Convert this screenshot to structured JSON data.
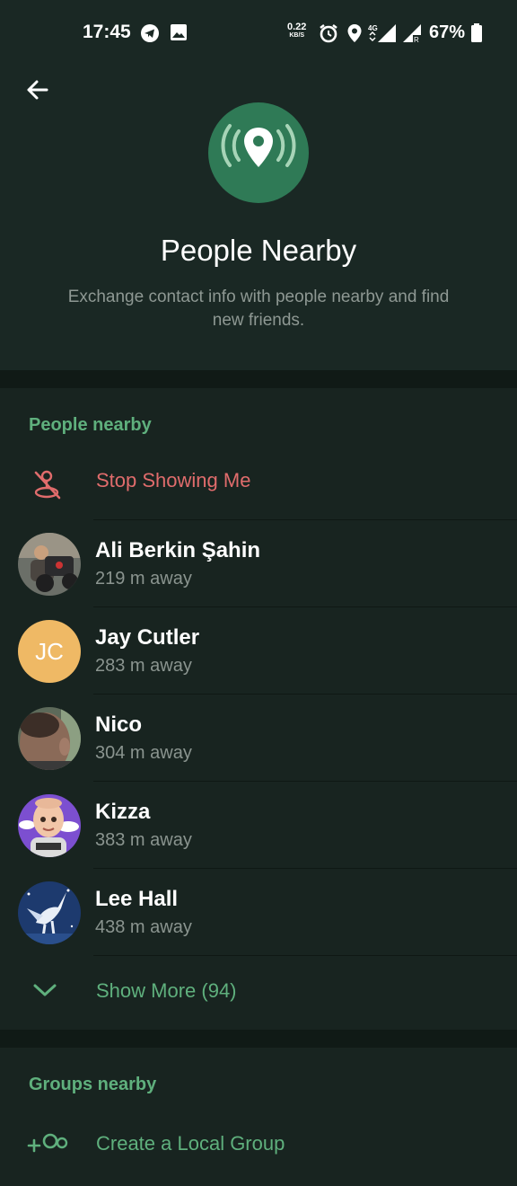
{
  "status_bar": {
    "time": "17:45",
    "net_speed": "0.22",
    "net_unit": "KB/S",
    "network": "4G",
    "battery": "67%",
    "icons": [
      "telegram-icon",
      "gallery-icon",
      "alarm-icon",
      "location-icon",
      "signal-icon",
      "signal-roaming-icon",
      "battery-icon"
    ]
  },
  "header": {
    "title": "People Nearby",
    "subtitle": "Exchange contact info with people nearby and find new friends.",
    "hero_icon": "location-broadcast-icon"
  },
  "people_section": {
    "header": "People nearby",
    "stop_action": "Stop Showing Me",
    "people": [
      {
        "name": "Ali Berkin Şahin",
        "distance": "219 m away",
        "avatar": "photo"
      },
      {
        "name": "Jay Cutler",
        "distance": "283 m away",
        "avatar": "initials",
        "initials": "JC",
        "color": "#efb965"
      },
      {
        "name": "Nico",
        "distance": "304 m away",
        "avatar": "photo"
      },
      {
        "name": "Kizza",
        "distance": "383 m away",
        "avatar": "photo"
      },
      {
        "name": "Lee Hall",
        "distance": "438 m away",
        "avatar": "photo"
      }
    ],
    "show_more": "Show More (94)"
  },
  "groups_section": {
    "header": "Groups nearby",
    "create_action": "Create a Local Group"
  },
  "colors": {
    "accent_green": "#5fb07d",
    "stop_red": "#e06c6c",
    "background": "#182420",
    "hero_green": "#2f7a56"
  }
}
